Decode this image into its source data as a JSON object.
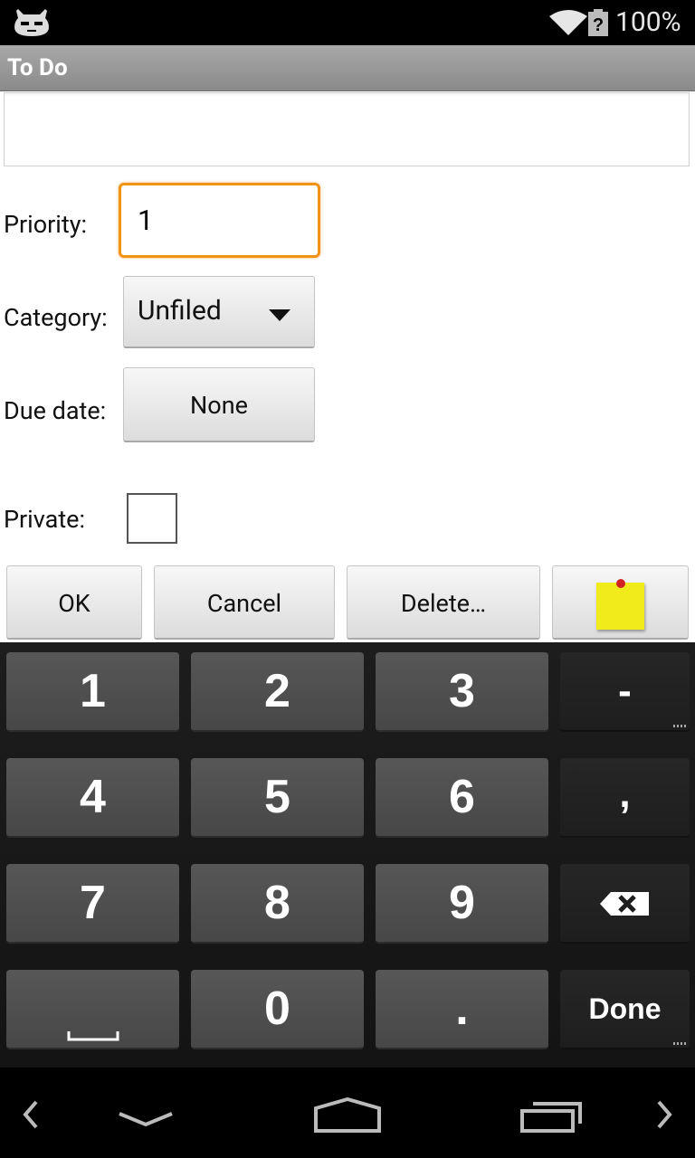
{
  "status_bar": {
    "battery_percent": "100%"
  },
  "app": {
    "title": "To Do"
  },
  "form": {
    "description_value": "",
    "priority_label": "Priority:",
    "priority_value": "1",
    "category_label": "Category:",
    "category_value": "Unfiled",
    "due_date_label": "Due date:",
    "due_date_value": "None",
    "private_label": "Private:",
    "private_checked": false
  },
  "buttons": {
    "ok": "OK",
    "cancel": "Cancel",
    "delete": "Delete…"
  },
  "keyboard": {
    "row1": [
      "1",
      "2",
      "3",
      "-"
    ],
    "row2": [
      "4",
      "5",
      "6",
      ","
    ],
    "row3": [
      "7",
      "8",
      "9"
    ],
    "row4": [
      "0",
      "."
    ],
    "done": "Done"
  }
}
